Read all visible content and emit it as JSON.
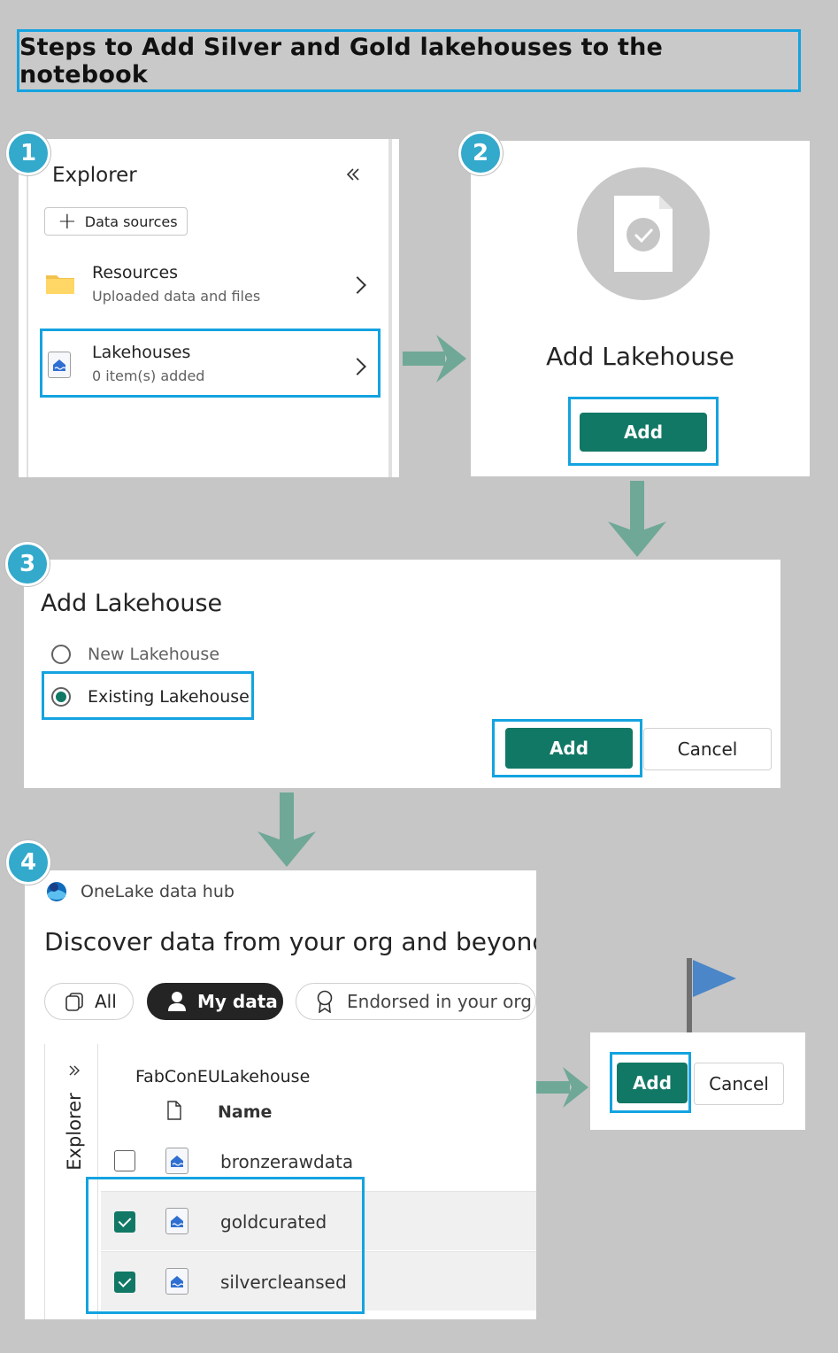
{
  "title": "Steps to Add Silver and Gold lakehouses to the notebook",
  "steps": {
    "s1": "1",
    "s2": "2",
    "s3": "3",
    "s4": "4"
  },
  "explorer": {
    "title": "Explorer",
    "data_sources_label": "Data sources",
    "items": [
      {
        "title": "Resources",
        "subtitle": "Uploaded data and files",
        "icon": "folder-icon"
      },
      {
        "title": "Lakehouses",
        "subtitle": "0 item(s) added",
        "icon": "lakehouse-icon"
      }
    ]
  },
  "add_lakehouse_card": {
    "title": "Add Lakehouse",
    "add_label": "Add",
    "icon": "document-check-icon"
  },
  "add_lakehouse_dialog": {
    "title": "Add Lakehouse",
    "options": [
      {
        "label": "New Lakehouse",
        "selected": false
      },
      {
        "label": "Existing Lakehouse",
        "selected": true
      }
    ],
    "add_label": "Add",
    "cancel_label": "Cancel"
  },
  "onelake": {
    "app_title": "OneLake data hub",
    "heading": "Discover data from your org and beyond",
    "filters": [
      {
        "label": "All",
        "active": false,
        "icon": "copy-icon"
      },
      {
        "label": "My data",
        "active": true,
        "icon": "person-icon"
      },
      {
        "label": "Endorsed in your org",
        "active": false,
        "icon": "ribbon-icon"
      }
    ],
    "side_panel_label": "Explorer",
    "workspace": "FabConEULakehouse",
    "column_name": "Name",
    "rows": [
      {
        "name": "bronzerawdata",
        "checked": false
      },
      {
        "name": "goldcurated",
        "checked": true
      },
      {
        "name": "silvercleansed",
        "checked": true
      }
    ]
  },
  "final_dialog": {
    "add_label": "Add",
    "cancel_label": "Cancel"
  },
  "colors": {
    "accent_green": "#117865",
    "highlight_blue": "#14a3e0",
    "badge": "#33a9cc",
    "arrow": "#6fa896"
  }
}
